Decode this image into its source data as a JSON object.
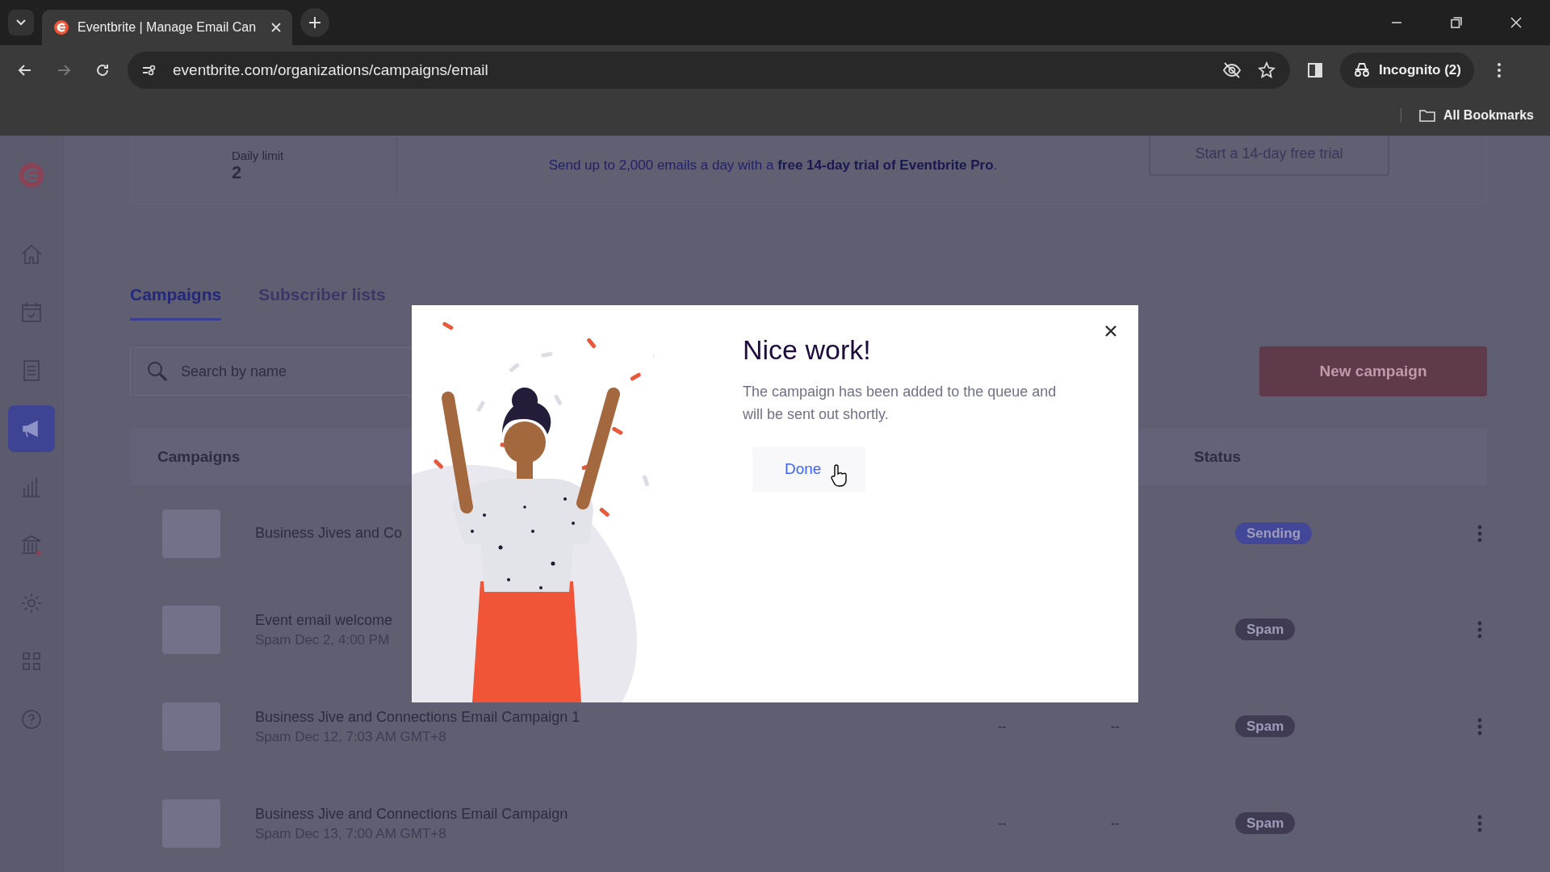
{
  "browser": {
    "tab_title": "Eventbrite | Manage Email Can",
    "url": "eventbrite.com/organizations/campaigns/email",
    "profile": "Incognito (2)",
    "bookmarks": "All Bookmarks"
  },
  "sidebar": {
    "items": [
      {
        "kind": "home",
        "selected": false
      },
      {
        "kind": "calendar",
        "selected": false
      },
      {
        "kind": "list",
        "selected": false
      },
      {
        "kind": "megaphone",
        "selected": true
      },
      {
        "kind": "chart",
        "selected": false
      },
      {
        "kind": "bank",
        "selected": false
      },
      {
        "kind": "gear",
        "selected": false
      },
      {
        "kind": "grid",
        "selected": false
      },
      {
        "kind": "help",
        "selected": false
      }
    ]
  },
  "banner": {
    "label": "Daily limit",
    "value": "2",
    "text": "Send up to 2,000 emails a day with a **free 14-day trial of Eventbrite Pro**.",
    "button": "Start a 14-day free trial"
  },
  "tabs": [
    {
      "label": "Campaigns",
      "selected": true
    },
    {
      "label": "Subscriber lists",
      "selected": false
    }
  ],
  "search": {
    "placeholder": "Search by name"
  },
  "new_button": "New campaign",
  "table": {
    "columns": [
      "Campaigns",
      "Status"
    ],
    "rows": [
      {
        "title": "Business Jives and Co",
        "status": "Sending",
        "color": "#424797"
      },
      {
        "title": "Event email welcome",
        "subtitle": "Spam Dec 2, 4:00 PM",
        "status": "Spam",
        "color": "#3e3b52"
      },
      {
        "title": "Business Jive and Connections Email Campaign 1",
        "subtitle": "Spam Dec 12, 7:03 AM GMT+8",
        "column_2": "--",
        "column_3": "--",
        "status": "Spam",
        "color": "#3e3b52"
      },
      {
        "title": "Business Jive and Connections Email Campaign",
        "subtitle": "Spam Dec 13, 7:00 AM GMT+8",
        "column_2": "--",
        "column_3": "--",
        "status": "Spam",
        "color": "#3e3b52"
      }
    ]
  },
  "modal": {
    "title": "Nice work!",
    "message": "The campaign has been added to the queue and will be sent out shortly.",
    "button": "Done"
  }
}
